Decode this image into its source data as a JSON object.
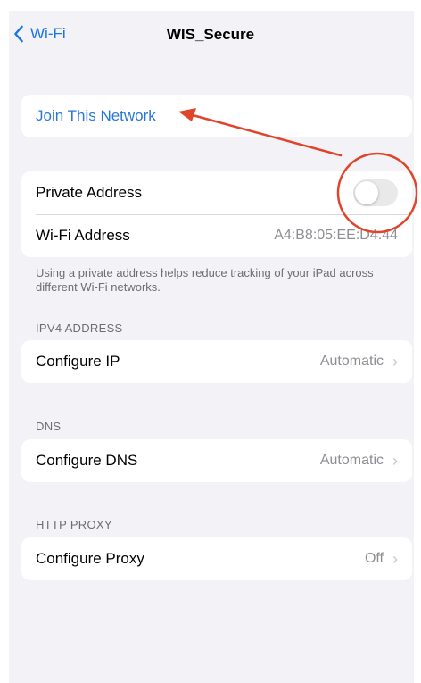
{
  "nav": {
    "back_label": "Wi-Fi",
    "title": "WIS_Secure"
  },
  "join": {
    "label": "Join This Network"
  },
  "privacy": {
    "private_address_label": "Private Address",
    "private_address_on": false,
    "wifi_address_label": "Wi-Fi Address",
    "wifi_address_value": "A4:B8:05:EE:D4:44",
    "footnote": "Using a private address helps reduce tracking of your iPad across different Wi-Fi networks."
  },
  "ipv4": {
    "header": "IPV4 ADDRESS",
    "configure_label": "Configure IP",
    "configure_value": "Automatic"
  },
  "dns": {
    "header": "DNS",
    "configure_label": "Configure DNS",
    "configure_value": "Automatic"
  },
  "proxy": {
    "header": "HTTP PROXY",
    "configure_label": "Configure Proxy",
    "configure_value": "Off"
  },
  "annotation": {
    "color": "#e0442a"
  },
  "colors": {
    "accent": "#2878d6",
    "background": "#f2f2f7",
    "annotation": "#e0442a"
  }
}
